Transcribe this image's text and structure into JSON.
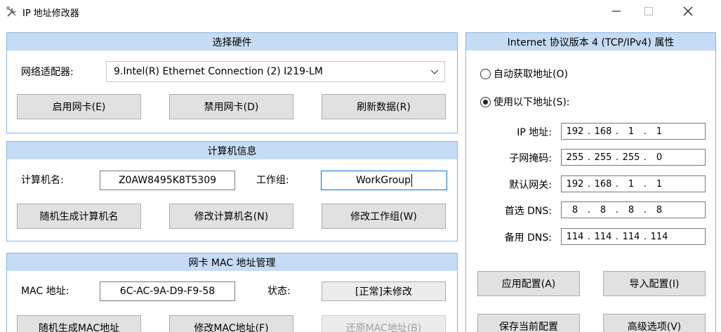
{
  "window": {
    "title": "IP 地址修改器"
  },
  "hardware": {
    "header": "选择硬件",
    "adapter_label": "网络适配器:",
    "adapter_value": "9.Intel(R) Ethernet Connection (2) I219-LM",
    "enable_btn": "启用网卡(E)",
    "disable_btn": "禁用网卡(D)",
    "refresh_btn": "刷新数据(R)"
  },
  "computer": {
    "header": "计算机信息",
    "name_label": "计算机名:",
    "name_value": "Z0AW8495K8T5309",
    "workgroup_label": "工作组:",
    "workgroup_value": "WorkGroup",
    "random_btn": "随机生成计算机名",
    "rename_btn": "修改计算机名(N)",
    "change_wg_btn": "修改工作组(W)"
  },
  "mac": {
    "header": "网卡 MAC 地址管理",
    "mac_label": "MAC 地址:",
    "mac_value": "6C-AC-9A-D9-F9-58",
    "status_label": "状态:",
    "status_value": "[正常]未修改",
    "random_btn": "随机生成MAC地址",
    "modify_btn": "修改MAC地址(F)",
    "restore_btn": "还原MAC地址(B)"
  },
  "ipv4": {
    "header": "Internet 协议版本 4 (TCP/IPv4) 属性",
    "auto_radio": "自动获取地址(O)",
    "manual_radio": "使用以下地址(S):",
    "selected": "manual",
    "rows": [
      {
        "label": "IP 地址:",
        "octets": [
          "192",
          "168",
          "1",
          "1"
        ]
      },
      {
        "label": "子网掩码:",
        "octets": [
          "255",
          "255",
          "255",
          "0"
        ]
      },
      {
        "label": "默认网关:",
        "octets": [
          "192",
          "168",
          "1",
          "1"
        ]
      },
      {
        "label": "首选 DNS:",
        "octets": [
          "8",
          "8",
          "8",
          "8"
        ]
      },
      {
        "label": "备用 DNS:",
        "octets": [
          "114",
          "114",
          "114",
          "114"
        ]
      }
    ],
    "apply_btn": "应用配置(A)",
    "import_btn": "导入配置(I)",
    "save_btn": "保存当前配置",
    "advanced_btn": "高级选项(V)"
  }
}
